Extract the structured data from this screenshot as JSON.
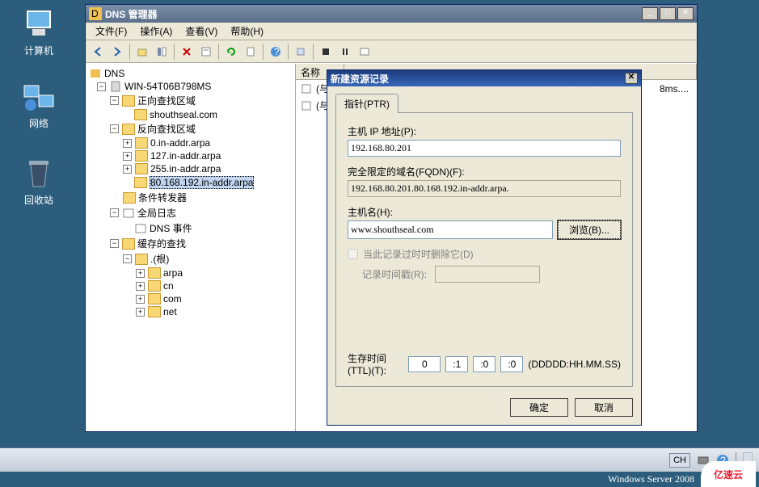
{
  "desktop": {
    "computer": "计算机",
    "network": "网络",
    "recycle": "回收站"
  },
  "window": {
    "title": "DNS 管理器",
    "menu": {
      "file": "文件(F)",
      "action": "操作(A)",
      "view": "查看(V)",
      "help": "帮助(H)"
    }
  },
  "tree": {
    "root": "DNS",
    "server": "WIN-54T06B798MS",
    "fwd_zone": "正向查找区域",
    "fwd_domain": "shouthseal.com",
    "rev_zone": "反向查找区域",
    "rev_items": [
      "0.in-addr.arpa",
      "127.in-addr.arpa",
      "255.in-addr.arpa",
      "80.168.192.in-addr.arpa"
    ],
    "cond_fwd": "条件转发器",
    "global_log": "全局日志",
    "dns_events": "DNS 事件",
    "cached_lookup": "缓存的查找",
    "root_hint": ".(根)",
    "cache_items": [
      "arpa",
      "cn",
      "com",
      "net"
    ]
  },
  "list": {
    "col_name": "名称",
    "row1": "(与",
    "row2": "(与",
    "row_trail": "8ms...."
  },
  "dialog": {
    "title": "新建资源记录",
    "tab_label": "指针(PTR)",
    "host_ip_label": "主机 IP 地址(P):",
    "host_ip_value": "192.168.80.201",
    "fqdn_label": "完全限定的域名(FQDN)(F):",
    "fqdn_value": "192.168.80.201.80.168.192.in-addr.arpa.",
    "hostname_label": "主机名(H):",
    "hostname_value": "www.shouthseal.com",
    "browse_btn": "浏览(B)...",
    "delete_check": "当此记录过时时删除它(D)",
    "ttl_sub_label": "记录时间戳(R):",
    "ttl_label": "生存时间(TTL)(T):",
    "ttl_d": "0",
    "ttl_h": ":1",
    "ttl_m": ":0",
    "ttl_s": ":0",
    "ttl_hint": "(DDDDD:HH.MM.SS)",
    "ok": "确定",
    "cancel": "取消"
  },
  "taskbar": {
    "ime": "CH"
  },
  "watermark": "Windows Server 2008",
  "logo": "亿速云"
}
